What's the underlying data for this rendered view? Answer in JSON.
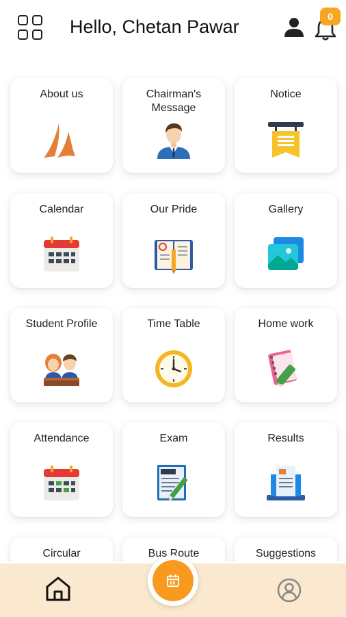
{
  "header": {
    "greeting": "Hello, Chetan Pawar",
    "notification_count": "0",
    "icons": {
      "menu": "grid-menu-icon",
      "user": "user-icon",
      "notifications": "bell-icon"
    }
  },
  "tiles": [
    {
      "label": "About us",
      "icon": "logo-sails-icon"
    },
    {
      "label": "Chairman's Message",
      "icon": "businessman-icon"
    },
    {
      "label": "Notice",
      "icon": "notice-board-icon"
    },
    {
      "label": "Calendar",
      "icon": "calendar-icon"
    },
    {
      "label": "Our Pride",
      "icon": "open-book-icon"
    },
    {
      "label": "Gallery",
      "icon": "photo-gallery-icon"
    },
    {
      "label": "Student Profile",
      "icon": "students-icon"
    },
    {
      "label": "Time Table",
      "icon": "clock-icon"
    },
    {
      "label": "Home work",
      "icon": "notebook-pencil-icon"
    },
    {
      "label": "Attendance",
      "icon": "attendance-calendar-icon"
    },
    {
      "label": "Exam",
      "icon": "exam-paper-icon"
    },
    {
      "label": "Results",
      "icon": "results-report-icon"
    },
    {
      "label": "Circular",
      "icon": "circular-icon"
    },
    {
      "label": "Bus Route",
      "icon": "bus-route-icon"
    },
    {
      "label": "Suggestions",
      "icon": "suggestions-icon"
    }
  ],
  "bottom_nav": {
    "home": "home-icon",
    "center": "calendar-fab-icon",
    "profile": "profile-icon"
  },
  "colors": {
    "accent": "#f79a1e",
    "badge": "#f6a623",
    "bottom_bar": "#fbe9cf",
    "text": "#222222"
  }
}
